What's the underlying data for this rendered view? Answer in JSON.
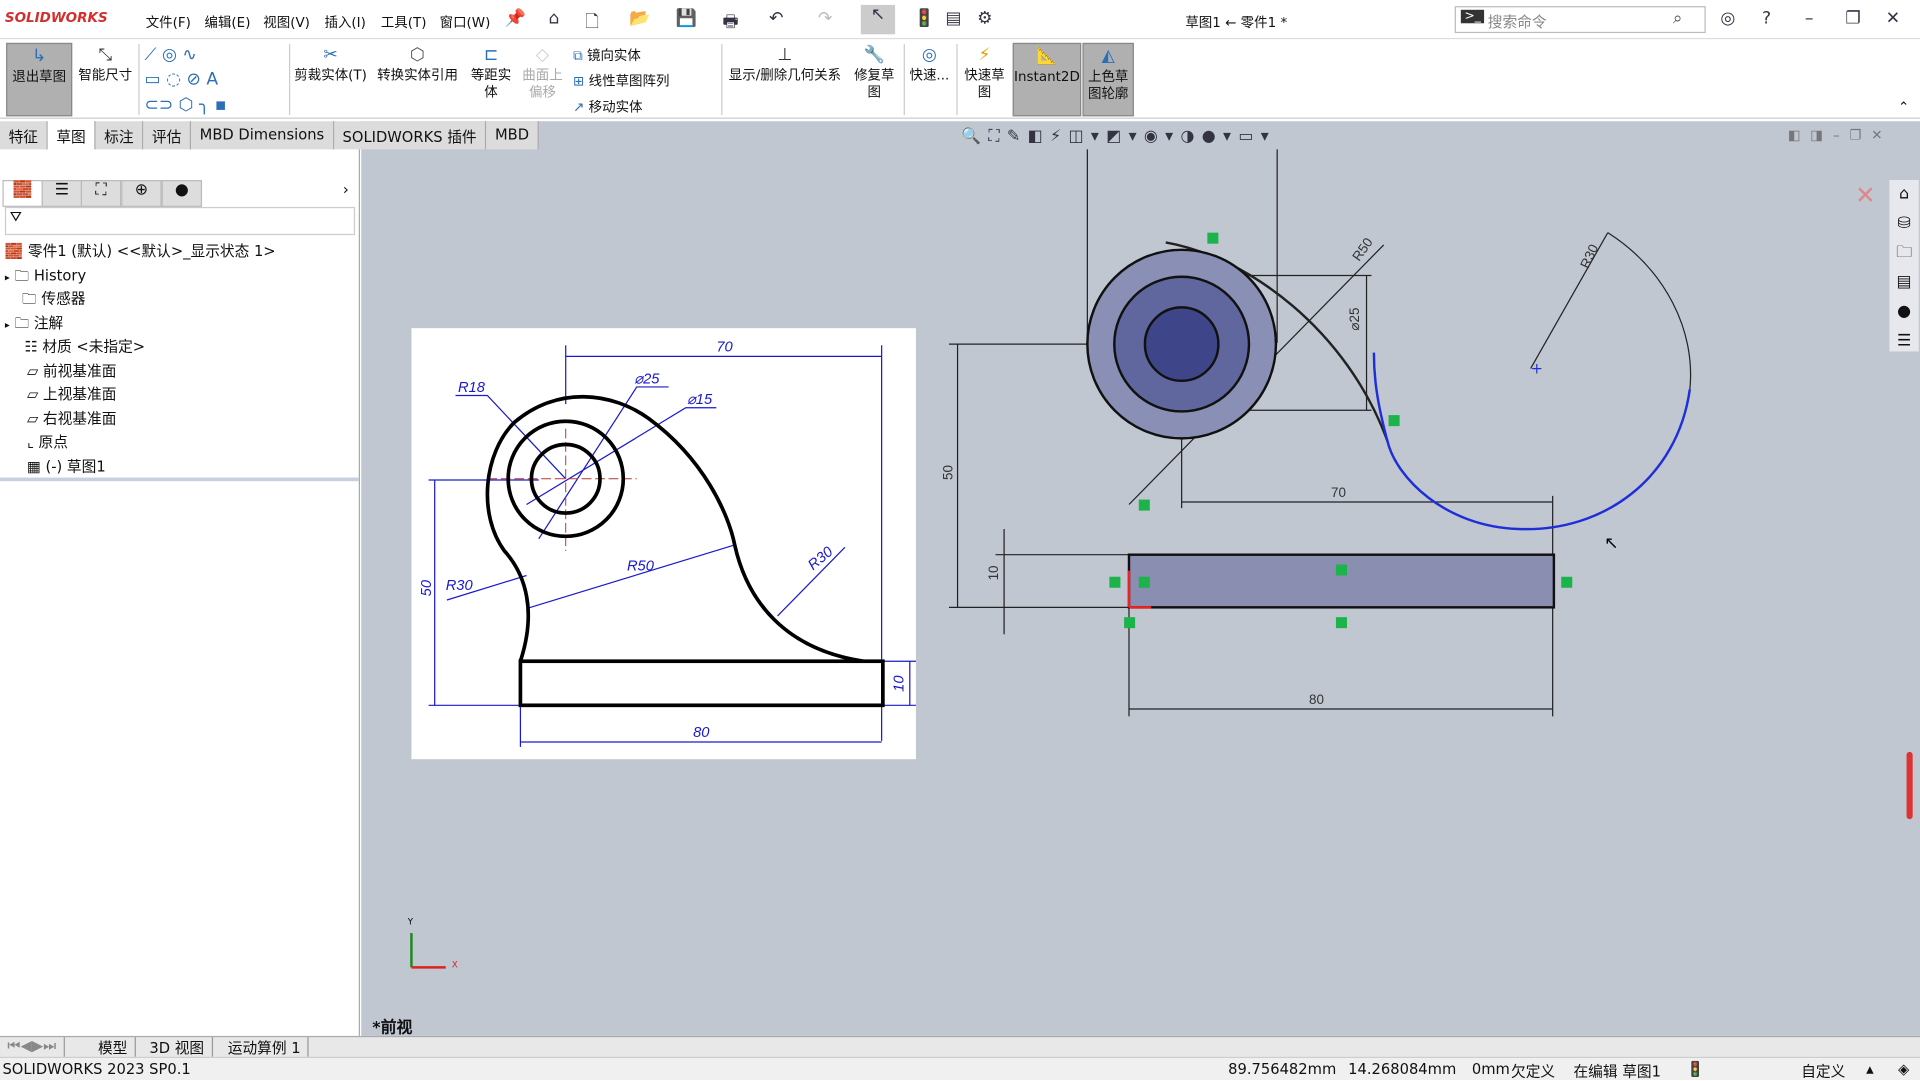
{
  "app": {
    "logo": "SOLIDWORKS",
    "title": "草图1 ← 零件1 *",
    "search_placeholder": "搜索命令"
  },
  "menu": [
    "文件(F)",
    "编辑(E)",
    "视图(V)",
    "插入(I)",
    "工具(T)",
    "窗口(W)"
  ],
  "ribbon": {
    "exit_sketch": "退出草图",
    "smart_dim": "智能尺寸",
    "trim": "剪裁实体(T)",
    "convert": "转换实体引用",
    "offset": "等距实体",
    "surface_offset": "曲面上偏移",
    "mirror": "镜向实体",
    "linear_pattern": "线性草图阵列",
    "move": "移动实体",
    "relations": "显示/删除几何关系",
    "repair": "修复草图",
    "quick": "快速...",
    "quick_sketch": "快速草图",
    "instant2d": "Instant2D",
    "shaded": "上色草图轮廓"
  },
  "tabs": [
    "特征",
    "草图",
    "标注",
    "评估",
    "MBD Dimensions",
    "SOLIDWORKS 插件",
    "MBD"
  ],
  "active_tab": "草图",
  "tree": {
    "root": "零件1 (默认) <<默认>_显示状态 1>",
    "items": [
      "History",
      "传感器",
      "注解",
      "材质 <未指定>",
      "前视基准面",
      "上视基准面",
      "右视基准面",
      "原点",
      "(-) 草图1"
    ]
  },
  "reference": {
    "dims": [
      "70",
      "R18",
      "⌀25",
      "⌀15",
      "50",
      "R30",
      "R50",
      "R30",
      "10",
      "80"
    ]
  },
  "sketch": {
    "dims": [
      "R50",
      "⌀25",
      "50",
      "70",
      "R30",
      "10",
      "80"
    ]
  },
  "view_label": "*前视",
  "bottom_tabs": [
    "模型",
    "3D 视图",
    "运动算例 1"
  ],
  "status": {
    "version": "SOLIDWORKS 2023 SP0.1",
    "x": "89.756482mm",
    "y": "14.268084mm",
    "z": "0mm",
    "state": "欠定义",
    "editing": "在编辑 草图1",
    "units": "自定义"
  },
  "colors": {
    "viewport": "#c1c7d1",
    "dim_blue": "#1a1acc",
    "sketch_blue": "#1f2fd8"
  }
}
